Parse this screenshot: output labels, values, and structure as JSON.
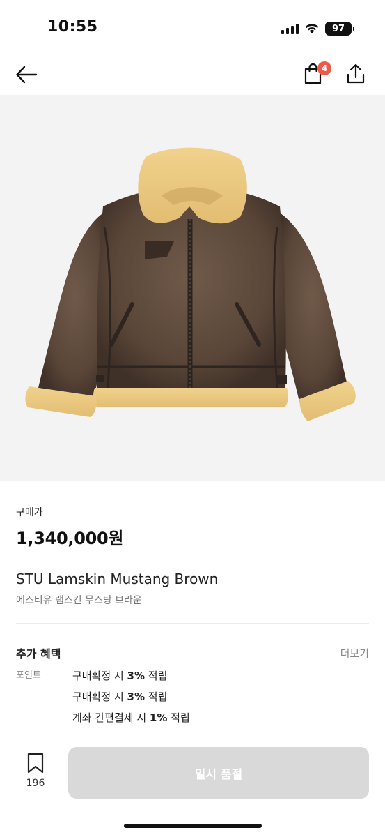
{
  "status": {
    "time": "10:55",
    "battery": "97"
  },
  "nav": {
    "cart_count": "4"
  },
  "product": {
    "price_label": "구매가",
    "price": "1,340,000원",
    "name_en": "STU Lamskin Mustang Brown",
    "name_ko": "에스티유 램스킨 무스탕 브라운"
  },
  "benefits": {
    "title": "추가 혜택",
    "more_label": "더보기",
    "rows": [
      {
        "type": "포인트",
        "prefix": "구매확정 시 ",
        "rate": "3%",
        "suffix": " 적립"
      },
      {
        "type": "",
        "prefix": "구매확정 시 ",
        "rate": "3%",
        "suffix": " 적립"
      },
      {
        "type": "",
        "prefix": "계좌 간편결제 시 ",
        "rate": "1%",
        "suffix": " 적립"
      }
    ]
  },
  "bottom": {
    "wish_count": "196",
    "buy_label": "일시 품절"
  },
  "colors": {
    "badge": "#ef5a46",
    "buy_disabled": "#d9d9d9",
    "image_bg": "#f3f3f3"
  },
  "icons": [
    "signal-icon",
    "wifi-icon",
    "battery-icon",
    "back-arrow-icon",
    "shopping-bag-icon",
    "share-icon",
    "bookmark-icon"
  ]
}
